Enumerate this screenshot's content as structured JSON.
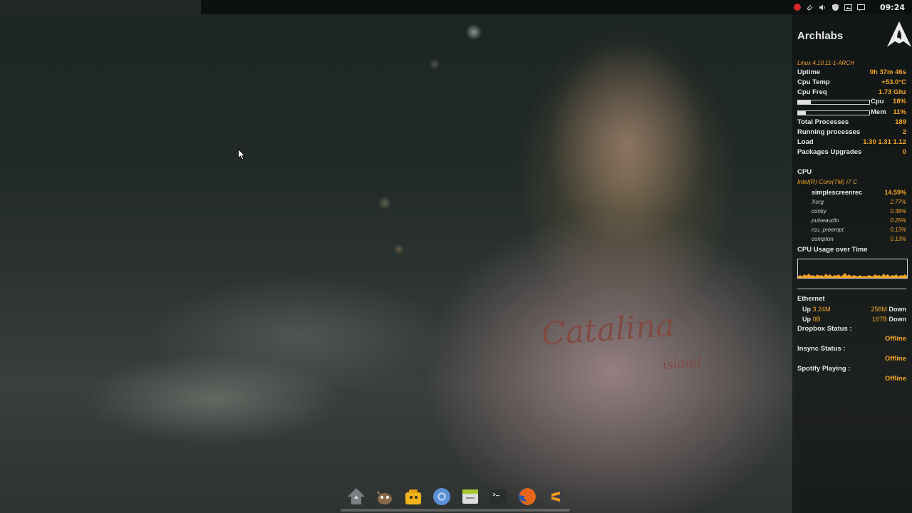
{
  "top_panel": {
    "clock": "09:24",
    "tray_icons": [
      "record-icon",
      "paperclip-icon",
      "volume-icon",
      "shield-icon",
      "image-icon",
      "message-icon"
    ]
  },
  "wallpaper": {
    "shirt_text": "Catalina",
    "shirt_subtext": "island"
  },
  "conky": {
    "title": "Archlabs",
    "kernel": "Linux 4.10.11-1-ARCH",
    "stats": [
      {
        "label": "Uptime",
        "value": "0h 37m 46s"
      },
      {
        "label": "Cpu Temp",
        "value": "+53.0°C"
      },
      {
        "label": "Cpu Freq",
        "value": "1.73 Ghz"
      }
    ],
    "bars": [
      {
        "label": "Cpu",
        "value": "18%",
        "fraction": 0.18
      },
      {
        "label": "Mem",
        "value": "11%",
        "fraction": 0.11
      }
    ],
    "stats2": [
      {
        "label": "Total Processes",
        "value": "189"
      },
      {
        "label": "Running processes",
        "value": "2"
      },
      {
        "label": "Load",
        "value": "1.30 1.31 1.12"
      },
      {
        "label": "Packages Upgrades",
        "value": "0"
      }
    ],
    "cpu_header": "CPU",
    "cpu_model": "Intel(R) Core(TM) i7 C",
    "processes": [
      {
        "name": "simplescreenrec",
        "value": "14.59%"
      },
      {
        "name": "Xorg",
        "value": "2.77%"
      },
      {
        "name": "conky",
        "value": "0.38%"
      },
      {
        "name": "pulseaudio",
        "value": "0.25%"
      },
      {
        "name": "rcu_preempt",
        "value": "0.13%"
      },
      {
        "name": "compton",
        "value": "0.13%"
      }
    ],
    "graph_label": "CPU Usage over Time",
    "ethernet_label": "Ethernet",
    "net": [
      {
        "up_label": "Up",
        "up_value": "3.24M",
        "down_value": "258M",
        "down_label": "Down"
      },
      {
        "up_label": "Up",
        "up_value": "0B",
        "down_value": "167B",
        "down_label": "Down"
      }
    ],
    "statuses": [
      {
        "label": "Dropbox Status :",
        "value": "Offline"
      },
      {
        "label": "Insync Status :",
        "value": "Offline"
      },
      {
        "label": "Spotify Playing :",
        "value": "Offline"
      }
    ]
  },
  "dock": {
    "items": [
      "menu-icon",
      "gimp-icon",
      "thunar-icon",
      "chromium-icon",
      "file-manager-icon",
      "terminal-icon",
      "firefox-icon",
      "sublime-text-icon"
    ]
  },
  "colors": {
    "accent": "#f5a623",
    "panel_bg": "#0c0e0e",
    "record_red": "#d6262b"
  }
}
